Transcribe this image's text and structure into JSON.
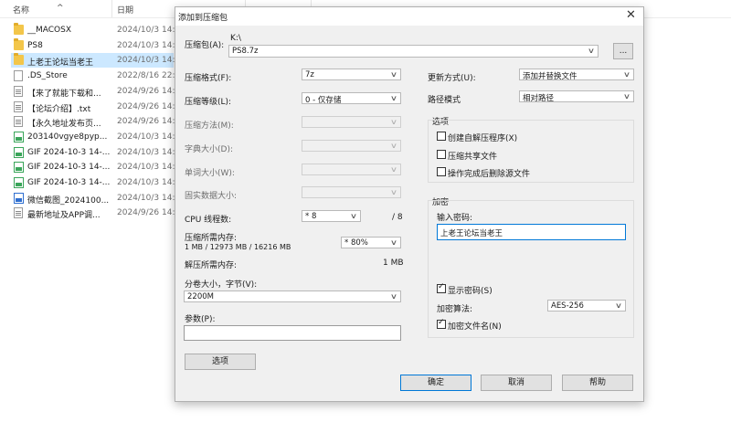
{
  "explorer": {
    "col_name": "名称",
    "col_date": "日期",
    "sort_arrow": "^",
    "files": [
      {
        "name": "__MACOSX",
        "date": "2024/10/3 14:",
        "icon": "folder-icon"
      },
      {
        "name": "PS8",
        "date": "2024/10/3 14:",
        "icon": "folder-icon"
      },
      {
        "name": "上老王论坛当老王",
        "date": "2024/10/3 14:",
        "icon": "folder-icon",
        "selected": true
      },
      {
        "name": ".DS_Store",
        "date": "2022/8/16 22:",
        "icon": "file-icon"
      },
      {
        "name": "【来了就能下载和...",
        "date": "2024/9/26 14:",
        "icon": "text-file-icon"
      },
      {
        "name": "【论坛介绍】.txt",
        "date": "2024/9/26 14:",
        "icon": "text-file-icon"
      },
      {
        "name": "【永久地址发布页...",
        "date": "2024/9/26 14:",
        "icon": "text-file-icon"
      },
      {
        "name": "203140vgye8pyp...",
        "date": "2024/10/3 14:",
        "icon": "image-file-icon"
      },
      {
        "name": "GIF 2024-10-3 14-...",
        "date": "2024/10/3 14:",
        "icon": "image-file-icon"
      },
      {
        "name": "GIF 2024-10-3 14-...",
        "date": "2024/10/3 14:",
        "icon": "image-file-icon"
      },
      {
        "name": "GIF 2024-10-3 14-...",
        "date": "2024/10/3 14:",
        "icon": "image-file-icon"
      },
      {
        "name": "微信截图_2024100...",
        "date": "2024/10/3 14:",
        "icon": "picture-file-icon"
      },
      {
        "name": "最新地址及APP调...",
        "date": "2024/9/26 14:",
        "icon": "text-file-icon"
      }
    ]
  },
  "dialog": {
    "title": "添加到压缩包",
    "close_glyph": "✕",
    "archive_label": "压缩包(A):",
    "archive_dir": "K:\\",
    "archive_name": "PS8.7z",
    "browse_label": "...",
    "format_label": "压缩格式(F):",
    "format_value": "7z",
    "level_label": "压缩等级(L):",
    "level_value": "0 - 仅存储",
    "method_label": "压缩方法(M):",
    "dict_label": "字典大小(D):",
    "word_label": "单词大小(W):",
    "solid_label": "固实数据大小:",
    "cpu_label": "CPU 线程数:",
    "cpu_value": "* 8",
    "cpu_max": "/ 8",
    "mem_comp_label": "压缩所需内存:",
    "mem_comp_detail": "1 MB / 12973 MB / 16216 MB",
    "mem_comp_value": "* 80%",
    "mem_decomp_label": "解压所需内存:",
    "mem_decomp_value": "1 MB",
    "split_label": "分卷大小，字节(V):",
    "split_value": "2200M",
    "params_label": "参数(P):",
    "params_value": "",
    "options_button": "选项",
    "update_label": "更新方式(U):",
    "update_value": "添加并替换文件",
    "path_label": "路径模式",
    "path_value": "相对路径",
    "options_group": "选项",
    "opt_sfx": "创建自解压程序(X)",
    "opt_shared": "压缩共享文件",
    "opt_delete": "操作完成后删除源文件",
    "encrypt_group": "加密",
    "password_label": "输入密码:",
    "password_value": "上老王论坛当老王",
    "show_password": "显示密码(S)",
    "enc_method_label": "加密算法:",
    "enc_method_value": "AES-256",
    "encrypt_names": "加密文件名(N)",
    "check_glyph": "✓",
    "chevron_glyph": "∨",
    "ok_button": "确定",
    "cancel_button": "取消",
    "help_button": "帮助"
  }
}
